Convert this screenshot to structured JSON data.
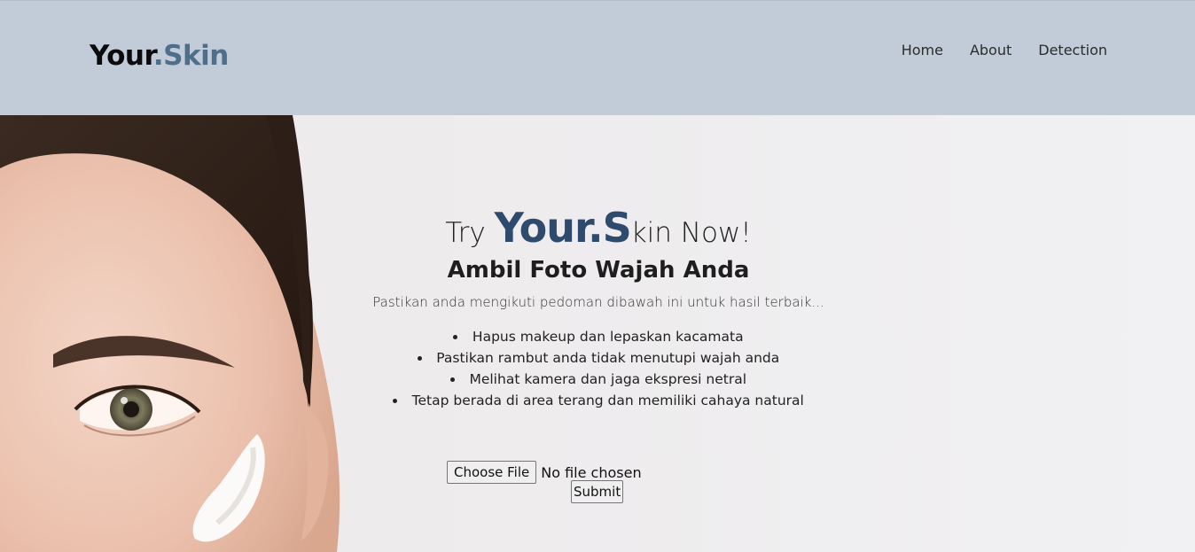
{
  "header": {
    "logo_main": "Your",
    "logo_accent": ".Skin",
    "nav": [
      {
        "label": "Home"
      },
      {
        "label": "About"
      },
      {
        "label": "Detection"
      }
    ]
  },
  "hero": {
    "try_prefix": "Try ",
    "try_brand": "Your.S",
    "try_suffix": "kin Now!",
    "subtitle": "Ambil Foto Wajah Anda",
    "guide": "Pastikan anda mengikuti pedoman dibawah ini untuk hasil terbaik...",
    "tips": [
      "Hapus makeup dan lepaskan kacamata",
      "Pastikan rambut anda tidak menutupi wajah anda",
      "Melihat kamera dan jaga ekspresi netral",
      "Tetap berada di area terang dan memiliki cahaya natural"
    ],
    "file_button": "Choose File",
    "file_status": "No file chosen",
    "submit": "Submit"
  },
  "colors": {
    "header_bg": "#c1ccd8",
    "logo_accent": "#4e6f8b",
    "brand_blue": "#2e4a6c"
  }
}
